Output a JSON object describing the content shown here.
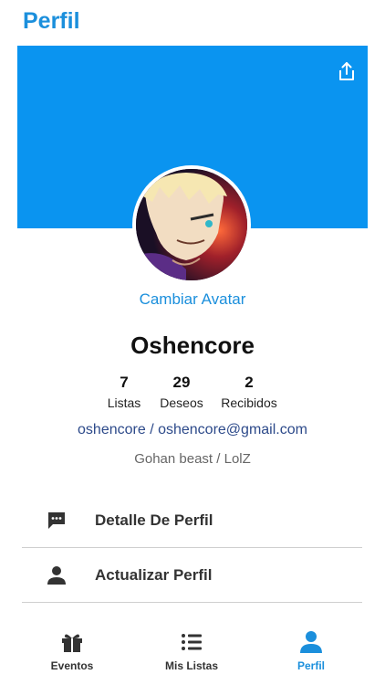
{
  "header": {
    "title": "Perfil"
  },
  "banner": {
    "share_icon": "share-icon",
    "color": "#0a94f0"
  },
  "profile": {
    "change_avatar_label": "Cambiar Avatar",
    "username": "Oshencore",
    "stats": [
      {
        "value": "7",
        "label": "Listas"
      },
      {
        "value": "29",
        "label": "Deseos"
      },
      {
        "value": "2",
        "label": "Recibidos"
      }
    ],
    "contact": "oshencore / oshencore@gmail.com",
    "bio": "Gohan beast / LolZ"
  },
  "menu": [
    {
      "icon": "message-icon",
      "label": "Detalle De Perfil"
    },
    {
      "icon": "person-icon",
      "label": "Actualizar Perfil"
    }
  ],
  "tabs": [
    {
      "icon": "gift-icon",
      "label": "Eventos",
      "active": false
    },
    {
      "icon": "list-icon",
      "label": "Mis Listas",
      "active": false
    },
    {
      "icon": "person-icon",
      "label": "Perfil",
      "active": true
    }
  ],
  "colors": {
    "accent": "#1b8fdc",
    "text_dark": "#333333",
    "link": "#2d4a8a"
  }
}
